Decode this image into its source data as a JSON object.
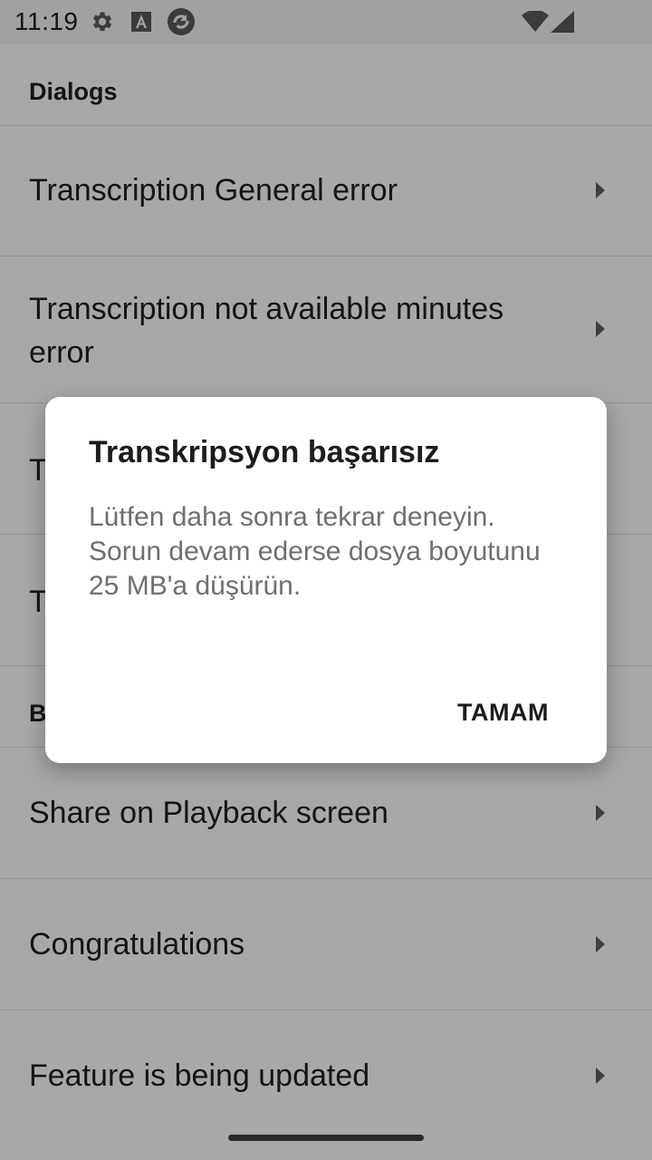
{
  "status_bar": {
    "time": "11:19",
    "icons_left": [
      "gear-icon",
      "font-a-icon",
      "sync-circle-icon"
    ],
    "icons_right": [
      "wifi-icon",
      "signal-icon"
    ]
  },
  "list": {
    "section_dialogs": "Dialogs",
    "items": [
      {
        "label": "Transcription General error"
      },
      {
        "label": "Transcription not available minutes error"
      },
      {
        "label": "T"
      },
      {
        "label": "T"
      }
    ],
    "section_b": "B",
    "items_b": [
      {
        "label": "Share on Playback screen"
      },
      {
        "label": "Congratulations"
      },
      {
        "label": "Feature is being updated"
      }
    ]
  },
  "dialog": {
    "title": "Transkripsyon başarısız",
    "message": "Lütfen daha sonra tekrar deneyin. Sorun devam ederse dosya boyutunu 25 MB'a düşürün.",
    "ok_label": "TAMAM"
  }
}
